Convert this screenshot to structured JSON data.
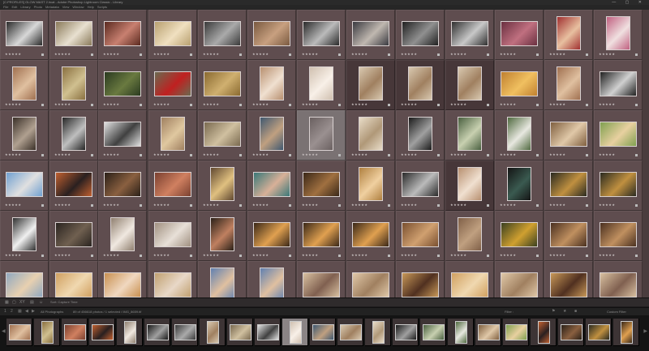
{
  "window": {
    "title": "[C:PROFILES] GLOW MAST 2.lrcat - Adobe Photoshop Lightroom Classic - Library",
    "controls": "— ▢ ✕"
  },
  "menu": [
    "File",
    "Edit",
    "Library",
    "Photo",
    "Metadata",
    "View",
    "Window",
    "Help",
    "Scripts"
  ],
  "grid": {
    "columns": 13,
    "rows": [
      {
        "tone": "mixed",
        "tags": [
          "bw",
          "bride-field",
          "bride-red",
          "couple-sun",
          "bw-couple",
          "couple-warm",
          "couple-bw",
          "couple-dance",
          "bw-dance",
          "couple-bw2",
          "party",
          "bride-hat",
          "bride-flowers"
        ]
      },
      {
        "tone": "mixed",
        "tags": [
          "couple-wall",
          "couple-field",
          "dark-green",
          "red-car",
          "golden-field",
          "portrait",
          "bride-bouquet",
          "doorway",
          "doorway",
          "doorway",
          "palms",
          "couple-wall",
          "bw-pose"
        ]
      },
      {
        "tone": "mixed",
        "tags": [
          "floor",
          "bw-portrait",
          "bw-wall",
          "woman-road",
          "couple-room",
          "blue-jacket",
          "drag-preview",
          "light-door",
          "bw-man",
          "garden-couple",
          "garden-bride",
          "couple-selfie",
          "green-woman"
        ]
      },
      {
        "tone": "mixed",
        "tags": [
          "street",
          "desert-orange",
          "moody",
          "orange-room",
          "woman-sit",
          "teal-portrait",
          "guitar",
          "blonde",
          "couple-bw",
          "portrait",
          "dark-bride",
          "castle",
          "castle"
        ]
      },
      {
        "tone": "mixed",
        "tags": [
          "bw-gown",
          "dark-suit",
          "bride-door",
          "couple-arch",
          "dark-man",
          "group",
          "group",
          "group",
          "arches",
          "stairs",
          "gold-crown",
          "arch-courtyard",
          "arch-courtyard"
        ]
      },
      {
        "tone": "desert",
        "tags": [
          "beach",
          "dunes",
          "dune-dress",
          "sand-pose",
          "sky-dress",
          "sky-dress",
          "desert-couple",
          "dune-walk",
          "desert-pose",
          "dunes",
          "dune-walk",
          "desert-pose",
          "desert-couple"
        ]
      }
    ]
  },
  "gridbar": {
    "sort_label": "Sort: Capture Time",
    "view_icons": [
      "grid-icon",
      "loupe-icon",
      "compare-icon",
      "survey-icon",
      "people-icon"
    ]
  },
  "filmstrip_bar": {
    "source": "All Photographs",
    "count": "89 of 456618 photos / 1 selected / IMG_8659.tif",
    "filter_label": "Filter :",
    "custom_filter": "Custom Filter",
    "page_numbers": [
      "1",
      "2"
    ]
  },
  "filmstrip": {
    "count": 23,
    "selected_index": 10
  },
  "colors": {
    "grid_bg": "#4a3d3e",
    "cell": "#5f4d4f",
    "cell_selected": "#473739",
    "cell_hover": "#7a7273",
    "panel": "#2f2b2c",
    "film_bg": "#141414"
  }
}
